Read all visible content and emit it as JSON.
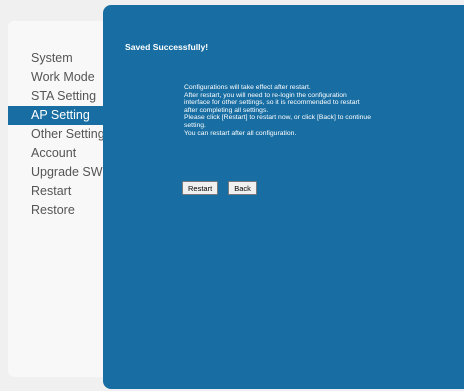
{
  "sidebar": {
    "items": [
      {
        "label": "System",
        "active": false
      },
      {
        "label": "Work Mode",
        "active": false
      },
      {
        "label": "STA Setting",
        "active": false
      },
      {
        "label": "AP Setting",
        "active": true
      },
      {
        "label": "Other Setting",
        "active": false
      },
      {
        "label": "Account",
        "active": false
      },
      {
        "label": "Upgrade SW",
        "active": false
      },
      {
        "label": "Restart",
        "active": false
      },
      {
        "label": "Restore",
        "active": false
      }
    ]
  },
  "main": {
    "title": "Saved Successfully!",
    "message_lines": [
      "Configurations will take effect after restart.",
      "After restart, you will need to re-login the configuration",
      "interface for other settings, so it is recommended to restart",
      "after completing all settings.",
      "Please click [Restart] to restart now, or click [Back] to continue",
      "setting.",
      "You can restart after all configuration."
    ],
    "restart_label": "Restart",
    "back_label": "Back"
  },
  "colors": {
    "accent": "#186ea3",
    "page_background": "#f0f0f0",
    "sidebar_background": "#f8f8f8",
    "sidebar_text": "#555555"
  }
}
